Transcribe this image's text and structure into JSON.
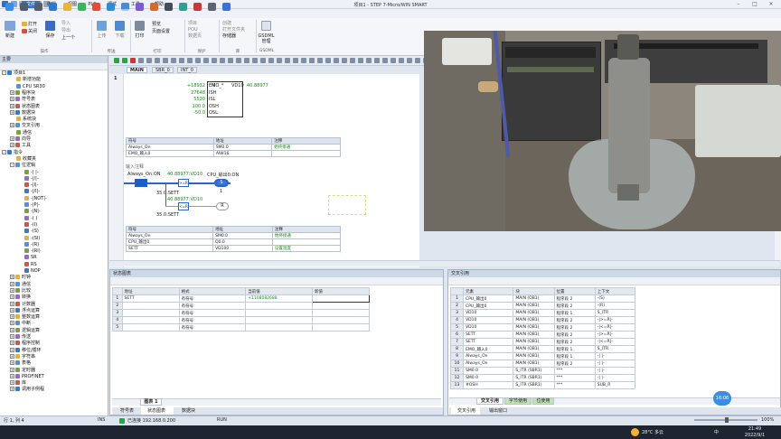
{
  "window": {
    "title": "项目1 - STEP 7-Micro/WIN SMART"
  },
  "menu": [
    "文件",
    "编辑",
    "视图",
    "PLC",
    "调试",
    "工具",
    "帮助"
  ],
  "ribbon": {
    "buttons": [
      {
        "label": "新建"
      },
      {
        "label": "打开"
      },
      {
        "label": "关闭"
      },
      {
        "label": "保存"
      },
      {
        "label": "导入"
      },
      {
        "label": "导出"
      },
      {
        "label": "上一个"
      },
      {
        "label": "上传"
      },
      {
        "label": "下载"
      },
      {
        "label": "打印"
      },
      {
        "label": "预览"
      },
      {
        "label": "页面设置"
      },
      {
        "label": "项目"
      },
      {
        "label": "POU"
      },
      {
        "label": "数据页"
      },
      {
        "label": "创建"
      },
      {
        "label": "打开文件夹"
      },
      {
        "label": "存储器"
      },
      {
        "label": "GSDML管理"
      }
    ],
    "group_labels": [
      "操作",
      "传送",
      "打印",
      "保护",
      "库",
      "GSDML"
    ]
  },
  "left_panel": {
    "header": "主要",
    "tree": [
      {
        "label": "项目1",
        "indent": 0,
        "exp": "-"
      },
      {
        "label": "新增功能",
        "indent": 1
      },
      {
        "label": "CPU SR30",
        "indent": 1
      },
      {
        "label": "程序块",
        "indent": 1,
        "exp": "+"
      },
      {
        "label": "符号表",
        "indent": 1,
        "exp": "+"
      },
      {
        "label": "状态图表",
        "indent": 1,
        "exp": "+"
      },
      {
        "label": "数据块",
        "indent": 1,
        "exp": "+"
      },
      {
        "label": "系统块",
        "indent": 1
      },
      {
        "label": "交叉引用",
        "indent": 1,
        "exp": "+"
      },
      {
        "label": "通信",
        "indent": 1
      },
      {
        "label": "向导",
        "indent": 1,
        "exp": "+"
      },
      {
        "label": "工具",
        "indent": 1,
        "exp": "+"
      },
      {
        "label": "指令",
        "indent": 0,
        "exp": "-"
      },
      {
        "label": "收藏夹",
        "indent": 1
      },
      {
        "label": "位逻辑",
        "indent": 1,
        "exp": "-"
      },
      {
        "label": "-| |-",
        "indent": 2
      },
      {
        "label": "-|/|-",
        "indent": 2
      },
      {
        "label": "-|I|-",
        "indent": 2
      },
      {
        "label": "-|/I|-",
        "indent": 2
      },
      {
        "label": "-|NOT|-",
        "indent": 2
      },
      {
        "label": "-|P|-",
        "indent": 2
      },
      {
        "label": "-|N|-",
        "indent": 2
      },
      {
        "label": "-( )",
        "indent": 2
      },
      {
        "label": "-(I)",
        "indent": 2
      },
      {
        "label": "-(S)",
        "indent": 2
      },
      {
        "label": "-(SI)",
        "indent": 2
      },
      {
        "label": "-(R)",
        "indent": 2
      },
      {
        "label": "-(RI)",
        "indent": 2
      },
      {
        "label": "SR",
        "indent": 2
      },
      {
        "label": "RS",
        "indent": 2
      },
      {
        "label": "NOP",
        "indent": 2
      },
      {
        "label": "时钟",
        "indent": 1,
        "exp": "+"
      },
      {
        "label": "通信",
        "indent": 1,
        "exp": "+"
      },
      {
        "label": "比较",
        "indent": 1,
        "exp": "+"
      },
      {
        "label": "转换",
        "indent": 1,
        "exp": "+"
      },
      {
        "label": "计数器",
        "indent": 1,
        "exp": "+"
      },
      {
        "label": "浮点运算",
        "indent": 1,
        "exp": "+"
      },
      {
        "label": "整数运算",
        "indent": 1,
        "exp": "+"
      },
      {
        "label": "中断",
        "indent": 1,
        "exp": "+"
      },
      {
        "label": "逻辑运算",
        "indent": 1,
        "exp": "+"
      },
      {
        "label": "传送",
        "indent": 1,
        "exp": "+"
      },
      {
        "label": "程序控制",
        "indent": 1,
        "exp": "+"
      },
      {
        "label": "移位/循环",
        "indent": 1,
        "exp": "+"
      },
      {
        "label": "字符串",
        "indent": 1,
        "exp": "+"
      },
      {
        "label": "表格",
        "indent": 1,
        "exp": "+"
      },
      {
        "label": "定时器",
        "indent": 1,
        "exp": "+"
      },
      {
        "label": "PROFINET",
        "indent": 1,
        "exp": "+"
      },
      {
        "label": "库",
        "indent": 1,
        "exp": "+"
      },
      {
        "label": "调用子例程",
        "indent": 1,
        "exp": "+"
      }
    ]
  },
  "editor": {
    "tabs": [
      "MAIN",
      "SBR_0",
      "INT_0"
    ],
    "network1": {
      "block_name": "EMO_*",
      "out_label": "VD10",
      "out_value": "40.88977",
      "inputs": [
        {
          "value": "+18932",
          "pin": "EN"
        },
        {
          "value": "27648",
          "pin": "ISH"
        },
        {
          "value": "5530",
          "pin": "ISL"
        },
        {
          "value": "100.0",
          "pin": "OSH"
        },
        {
          "value": "-50.0",
          "pin": "OSL"
        }
      ],
      "table": {
        "headers": [
          "符号",
          "地址",
          "注释"
        ],
        "rows": [
          [
            "Always_On",
            "SM0.0",
            "始终接通"
          ],
          [
            "EMO_输入0",
            "AIW16",
            ""
          ]
        ]
      }
    },
    "network2": {
      "number": "2",
      "comment": "输入注释",
      "always_on_label": "Always_On:ON",
      "contact_value1": "40.88977:VD10",
      "cpu_out_label": "CPU_输出0:ON",
      "compare1": ">=R",
      "compare1_value": "35.0:SETT",
      "contact_value2": "40.88977:VD10",
      "compare2": "<=R",
      "compare2_value": "35.0:SETT",
      "set_coil": "S",
      "reset_coil": "R",
      "coil_num": "1",
      "table": {
        "headers": [
          "符号",
          "地址",
          "注释"
        ],
        "rows": [
          [
            "Always_On",
            "SM0.0",
            "始终接通"
          ],
          [
            "CPU_输出0",
            "Q0.0",
            ""
          ],
          [
            "SETT",
            "VD100",
            "设置温度"
          ]
        ]
      }
    }
  },
  "status_chart": {
    "title": "状态图表",
    "headers": [
      "",
      "地址",
      "格式",
      "当前值",
      "新值"
    ],
    "rows": [
      [
        "1",
        "SETT",
        "有符号",
        "+1108082688",
        ""
      ],
      [
        "2",
        "",
        "有符号",
        "",
        ""
      ],
      [
        "3",
        "",
        "有符号",
        "",
        ""
      ],
      [
        "4",
        "",
        "有符号",
        "",
        ""
      ],
      [
        "5",
        "",
        "有符号",
        "",
        ""
      ]
    ],
    "sheet_tab": "图表 1",
    "bottom_tabs": [
      "符号表",
      "状态图表",
      "数据块"
    ]
  },
  "cross_ref": {
    "title": "交叉引用",
    "headers": [
      "",
      "元素",
      "块",
      "位置",
      "上下文"
    ],
    "rows": [
      [
        "1",
        "CPU_输出0",
        "MAIN (OB1)",
        "程序段 2",
        "-(S)"
      ],
      [
        "2",
        "CPU_输出0",
        "MAIN (OB1)",
        "程序段 2",
        "-(R)"
      ],
      [
        "3",
        "VD10",
        "MAIN (OB1)",
        "程序段 1",
        "S_ITR"
      ],
      [
        "4",
        "VD10",
        "MAIN (OB1)",
        "程序段 2",
        "-|>=R|-"
      ],
      [
        "5",
        "VD10",
        "MAIN (OB1)",
        "程序段 2",
        "-|<=R|-"
      ],
      [
        "6",
        "SETT",
        "MAIN (OB1)",
        "程序段 2",
        "-|>=R|-"
      ],
      [
        "7",
        "SETT",
        "MAIN (OB1)",
        "程序段 2",
        "-|<=R|-"
      ],
      [
        "8",
        "EMO_输入0",
        "MAIN (OB1)",
        "程序段 1",
        "S_ITR"
      ],
      [
        "9",
        "Always_On",
        "MAIN (OB1)",
        "程序段 1",
        "-| |-"
      ],
      [
        "10",
        "Always_On",
        "MAIN (OB1)",
        "程序段 2",
        "-| |-"
      ],
      [
        "11",
        "SM0.0",
        "S_ITR (SBR1)",
        "***",
        "-| |-"
      ],
      [
        "12",
        "SM0.0",
        "S_ITR (SBR1)",
        "***",
        "-| |-"
      ],
      [
        "13",
        "#OSH",
        "S_ITR (SBR1)",
        "***",
        "SUB_R"
      ]
    ],
    "sheet_tabs": [
      "交叉引用",
      "字节使用",
      "位使用"
    ],
    "bottom_tabs": [
      "交叉引用",
      "输出窗口"
    ]
  },
  "status_bar": {
    "position": "行 1, 列 4",
    "ins": "INS",
    "connection": "已连接 192.168.0.200",
    "mode": "RUN",
    "zoom": "100%"
  },
  "taskbar": {
    "weather": "28°C 多云",
    "time": "21:49",
    "date": "2022/9/1",
    "lang": "中"
  },
  "overlay_time": "16:06"
}
